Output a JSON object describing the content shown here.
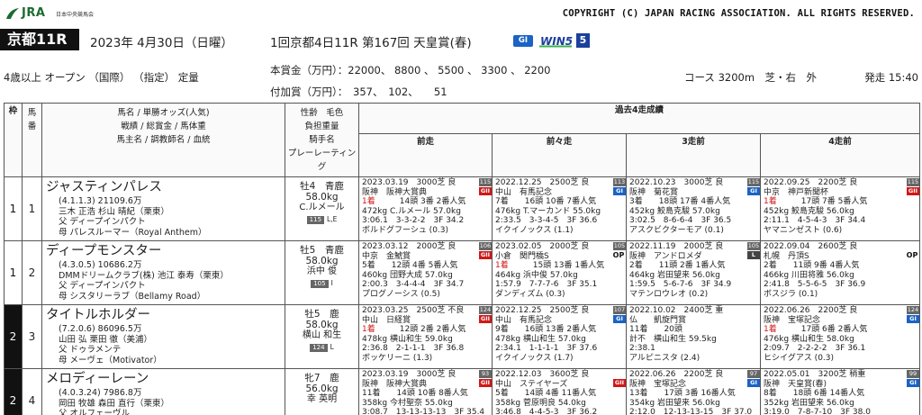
{
  "header": {
    "logo_text": "JRA",
    "logo_sub": "日本中央競馬会",
    "copyright": "COPYRIGHT (C) JAPAN RACING ASSOCIATION. ALL RIGHTS RESERVED."
  },
  "race": {
    "badge": "京都11R",
    "date": "2023年 4月30日（日曜）",
    "name": "1回京都4日11R 第167回 天皇賞(春)",
    "grade": "GI",
    "win5_label": "WIN5",
    "win5_num": "5",
    "conditions": "4歳以上 オープン （国際） （指定） 定量",
    "prize_line1": "本賞金（万円）：22000、 8800 、 5500 、 3300 、 2200",
    "prize_line2": "付加賞（万円）：　357、　102、　　51",
    "course": "コース 3200m　芝・右　外",
    "start": "発走 15:40"
  },
  "table_header": {
    "waku": "枠",
    "uma": "馬番",
    "horse_cols": [
      "馬名 / 単勝オッズ(人気)",
      "戦績 / 総賞金 / 馬体重",
      "馬主名 / 調教師名 / 血統"
    ],
    "wt_cols": [
      "性齢　毛色",
      "負担重量",
      "騎手名",
      "プレーレーティング"
    ],
    "past_title": "過去4走成績",
    "past_cols": [
      "前走",
      "前々走",
      "3走前",
      "4走前"
    ]
  },
  "entries": [
    {
      "waku": "1",
      "waku_class": "w1",
      "uma": "1",
      "name": "ジャスティンパレス",
      "odds": "(4.1.1.3) 21109.6万",
      "owner": "三木 正浩 杉山 晴紀（栗東）",
      "sire": "父 ディープインパクト",
      "dam": "母 パレスルーマー（Royal Anthem）",
      "sex_age": "牡4　青鹿",
      "weight": "58.0kg",
      "jockey": "C.ルメール",
      "rating": "115",
      "blink": "L,E",
      "past": [
        {
          "l1": "2023.03.19　3000芝 良",
          "l2": "阪神　阪神大賞典",
          "place": "1着",
          "l3": "　　　14頭 3番 2番人気",
          "l4": "472kg C.ルメール 57.0kg",
          "l5": "3:06.1　3-3-2-2　3F 34.2",
          "l6": "ボルドグフーシュ (0.3)",
          "rb": "115",
          "gb": "GII",
          "gc": "g2"
        },
        {
          "l1": "2022.12.25　2500芝 良",
          "l2": "中山　有馬記念",
          "place": "",
          "l3": "7着　　16頭 10番 7番人気",
          "l4": "476kg T.マーカンド 55.0kg",
          "l5": "2:33.5　3-3-4-5　3F 36.6",
          "l6": "イクイノックス (1.1)",
          "rb": "113",
          "gb": "GI",
          "gc": "g1"
        },
        {
          "l1": "2022.10.23　3000芝 良",
          "l2": "阪神　菊花賞",
          "place": "",
          "l3": "3着　　18頭 17番 4番人気",
          "l4": "452kg 鮫島克駿 57.0kg",
          "l5": "3:02.5　8-6-6-4　3F 36.5",
          "l6": "アスクビクターモア (0.1)",
          "rb": "115",
          "gb": "GI",
          "gc": "g1"
        },
        {
          "l1": "2022.09.25　2200芝 良",
          "l2": "中京　神戸新聞杯",
          "place": "1着",
          "l3": "　　　17頭 7番 5番人気",
          "l4": "452kg 鮫島克駿 56.0kg",
          "l5": "2:11.1　4-5-4-3　3F 34.4",
          "l6": "ヤマニンゼスト (0.6)",
          "rb": "115",
          "gb": "GII",
          "gc": "g2"
        }
      ]
    },
    {
      "waku": "1",
      "waku_class": "w1",
      "uma": "2",
      "name": "ディープモンスター",
      "odds": "(4.3.0.5) 10686.2万",
      "owner": "DMMドリームクラブ(株) 池江 泰寿（栗東）",
      "sire": "父 ディープインパクト",
      "dam": "母 シスタリーラブ（Bellamy Road）",
      "sex_age": "牡5　青鹿",
      "weight": "58.0kg",
      "jockey": "浜中 俊",
      "rating": "105",
      "blink": "I",
      "past": [
        {
          "l1": "2023.03.12　2000芝 良",
          "l2": "中京　金鯱賞",
          "place": "",
          "l3": "5着　　12頭 4番 5番人気",
          "l4": "460kg 団野大成 57.0kg",
          "l5": "2:00.3　3-4-4-4　3F 34.7",
          "l6": "プログノーシス (0.5)",
          "rb": "106",
          "gb": "GII",
          "gc": "g2"
        },
        {
          "l1": "2023.02.05　2000芝 良",
          "l2": "小倉　関門橋S",
          "place": "1着",
          "l3": "　　　15頭 13番 1番人気",
          "l4": "464kg 浜中俊 57.0kg",
          "l5": "1:57.9　7-7-7-6　3F 35.1",
          "l6": "ダンディズム (0.3)",
          "rb": "105",
          "gb": "OP",
          "gc": "op"
        },
        {
          "l1": "2022.11.19　2000芝 良",
          "l2": "阪神　アンドロメダ",
          "place": "",
          "l3": "2着　　11頭 2番 1番人気",
          "l4": "464kg 岩田望来 56.0kg",
          "l5": "1:59.5　5-6-7-6　3F 34.9",
          "l6": "マテンロウレオ (0.2)",
          "rb": "105",
          "gb": "L",
          "gc": "l"
        },
        {
          "l1": "2022.09.04　2600芝 良",
          "l2": "札幌　丹頂S",
          "place": "",
          "l3": "2着　　11頭 9番 4番人気",
          "l4": "466kg 川田将雅 56.0kg",
          "l5": "2:41.8　5-5-6-5　3F 36.9",
          "l6": "ボスジラ (0.1)",
          "rb": "",
          "gb": "OP",
          "gc": "op"
        }
      ]
    },
    {
      "waku": "2",
      "waku_class": "w2",
      "uma": "3",
      "name": "タイトルホルダー",
      "odds": "(7.2.0.6) 86096.5万",
      "owner": "山田 弘 栗田 徹（美浦）",
      "sire": "父 ドゥラメンテ",
      "dam": "母 メーヴェ（Motivator）",
      "sex_age": "牡5　鹿",
      "weight": "58.0kg",
      "jockey": "横山 和生",
      "rating": "124",
      "blink": "L",
      "past": [
        {
          "l1": "2023.03.25　2500芝 不良",
          "l2": "中山　日経賞",
          "place": "1着",
          "l3": "　　　12頭 2番 2番人気",
          "l4": "478kg 横山和生 59.0kg",
          "l5": "2:36.8　2-1-1-1　3F 36.8",
          "l6": "ボッケリーニ (1.3)",
          "rb": "124",
          "gb": "GII",
          "gc": "g2"
        },
        {
          "l1": "2022.12.25　2500芝 良",
          "l2": "中山　有馬記念",
          "place": "",
          "l3": "9着　　16頭 13番 2番人気",
          "l4": "478kg 横山和生 57.0kg",
          "l5": "2:34.1　1-1-1-1　3F 37.6",
          "l6": "イクイノックス (1.7)",
          "rb": "107",
          "gb": "GI",
          "gc": "g1"
        },
        {
          "l1": "2022.10.02　2400芝 重",
          "l2": "仏　　凱旋門賞",
          "place": "",
          "l3": "11着　　20頭",
          "l4": "計不　横山和生 59.5kg",
          "l5": "2:38.1",
          "l6": "アルピニスタ (2.4)",
          "rb": "",
          "gb": "",
          "gc": ""
        },
        {
          "l1": "2022.06.26　2200芝 良",
          "l2": "阪神　宝塚記念",
          "place": "1着",
          "l3": "　　　17頭 6番 2番人気",
          "l4": "476kg 横山和生 58.0kg",
          "l5": "2:09.7　2-2-2-2　3F 36.1",
          "l6": "ヒシイグアス (0.3)",
          "rb": "124",
          "gb": "GI",
          "gc": "g1"
        }
      ]
    },
    {
      "waku": "2",
      "waku_class": "w2",
      "uma": "4",
      "name": "メロディーレーン",
      "odds": "(4.0.3.24) 7986.8万",
      "owner": "岡田 牧雄 森田 直行（栗東）",
      "sire": "父 オルフェーヴル",
      "dam": "母 メーヴェ（Motivator）",
      "sex_age": "牝7　鹿",
      "weight": "56.0kg",
      "jockey": "幸 英明",
      "rating": "",
      "blink": "",
      "past": [
        {
          "l1": "2023.03.19　3000芝 良",
          "l2": "阪神　阪神大賞典",
          "place": "",
          "l3": "11着　　14頭 10番 8番人気",
          "l4": "358kg 今村聖奈 55.0kg",
          "l5": "3:08.7　13-13-13-13　3F 35.4",
          "l6": "ジャスティンパレス (2.6)",
          "rb": "93",
          "gb": "GII",
          "gc": "g2"
        },
        {
          "l1": "2022.12.03　3600芝 良",
          "l2": "中山　ステイヤーズ",
          "place": "",
          "l3": "5着　　14頭 4番 11番人気",
          "l4": "358kg 菅原明良 54.0kg",
          "l5": "3:46.8　4-4-5-3　3F 36.2",
          "l6": "シルヴァーソニック (0.9)",
          "rb": "",
          "gb": "GII",
          "gc": "g2"
        },
        {
          "l1": "2022.06.26　2200芝 良",
          "l2": "阪神　宝塚記念",
          "place": "",
          "l3": "13着　　17頭 3番 16番人気",
          "l4": "354kg 岩田望来 56.0kg",
          "l5": "2:12.0　12-13-13-15　3F 37.0",
          "l6": "タイトルホルダー (2.3)",
          "rb": "97",
          "gb": "GI",
          "gc": "g1"
        },
        {
          "l1": "2022.05.01　3200芝 稍重",
          "l2": "阪神　天皇賞(春)",
          "place": "",
          "l3": "8着　　18頭 6番 14番人気",
          "l4": "352kg 岩田望来 56.0kg",
          "l5": "3:19.0　7-8-7-10　3F 38.0",
          "l6": "タイトルホルダー (3.3)",
          "rb": "99",
          "gb": "GI",
          "gc": "g1"
        }
      ]
    }
  ],
  "colors": {
    "jra_green": "#1c6b2e",
    "grade1": "#1b63c4",
    "grade2": "#d01818",
    "win5_blue": "#1b3f9c"
  }
}
